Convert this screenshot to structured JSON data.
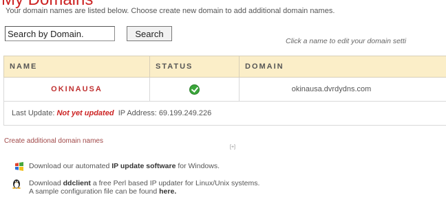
{
  "page": {
    "title": "My Domains",
    "intro": "Your domain names are listed below. Choose create new domain to add additional domain names."
  },
  "search": {
    "value": "Search by Domain.",
    "button_label": "Search"
  },
  "hint": "Click a name to edit your domain setti",
  "table": {
    "headers": {
      "name": "NAME",
      "status": "STATUS",
      "domain": "DOMAIN"
    },
    "rows": [
      {
        "name": "OKINAUSA",
        "status_icon": "check-circle-icon",
        "domain": "okinausa.dvrdydns.com"
      }
    ],
    "update": {
      "label": "Last Update:",
      "value": "Not yet updated",
      "ip_label": "IP Address:",
      "ip_value": "69.199.249.226"
    }
  },
  "links": {
    "create": "Create additional domain names"
  },
  "marker": "[+]",
  "downloads": {
    "windows": {
      "icon": "windows-icon",
      "prefix": "Download our automated",
      "link": "IP update software",
      "suffix": "for Windows."
    },
    "ddclient": {
      "icon": "linux-tux-icon",
      "prefix": "Download",
      "link": "ddclient",
      "suffix": "a free Perl based IP updater for Linux/Unix systems.",
      "line2_prefix": "A sample configuration file can be found",
      "line2_link": "here."
    }
  },
  "colors": {
    "title": "#cc2222",
    "header_bg": "#fbeec8",
    "status_ok": "#3aa63a",
    "warning": "#cc2222"
  }
}
